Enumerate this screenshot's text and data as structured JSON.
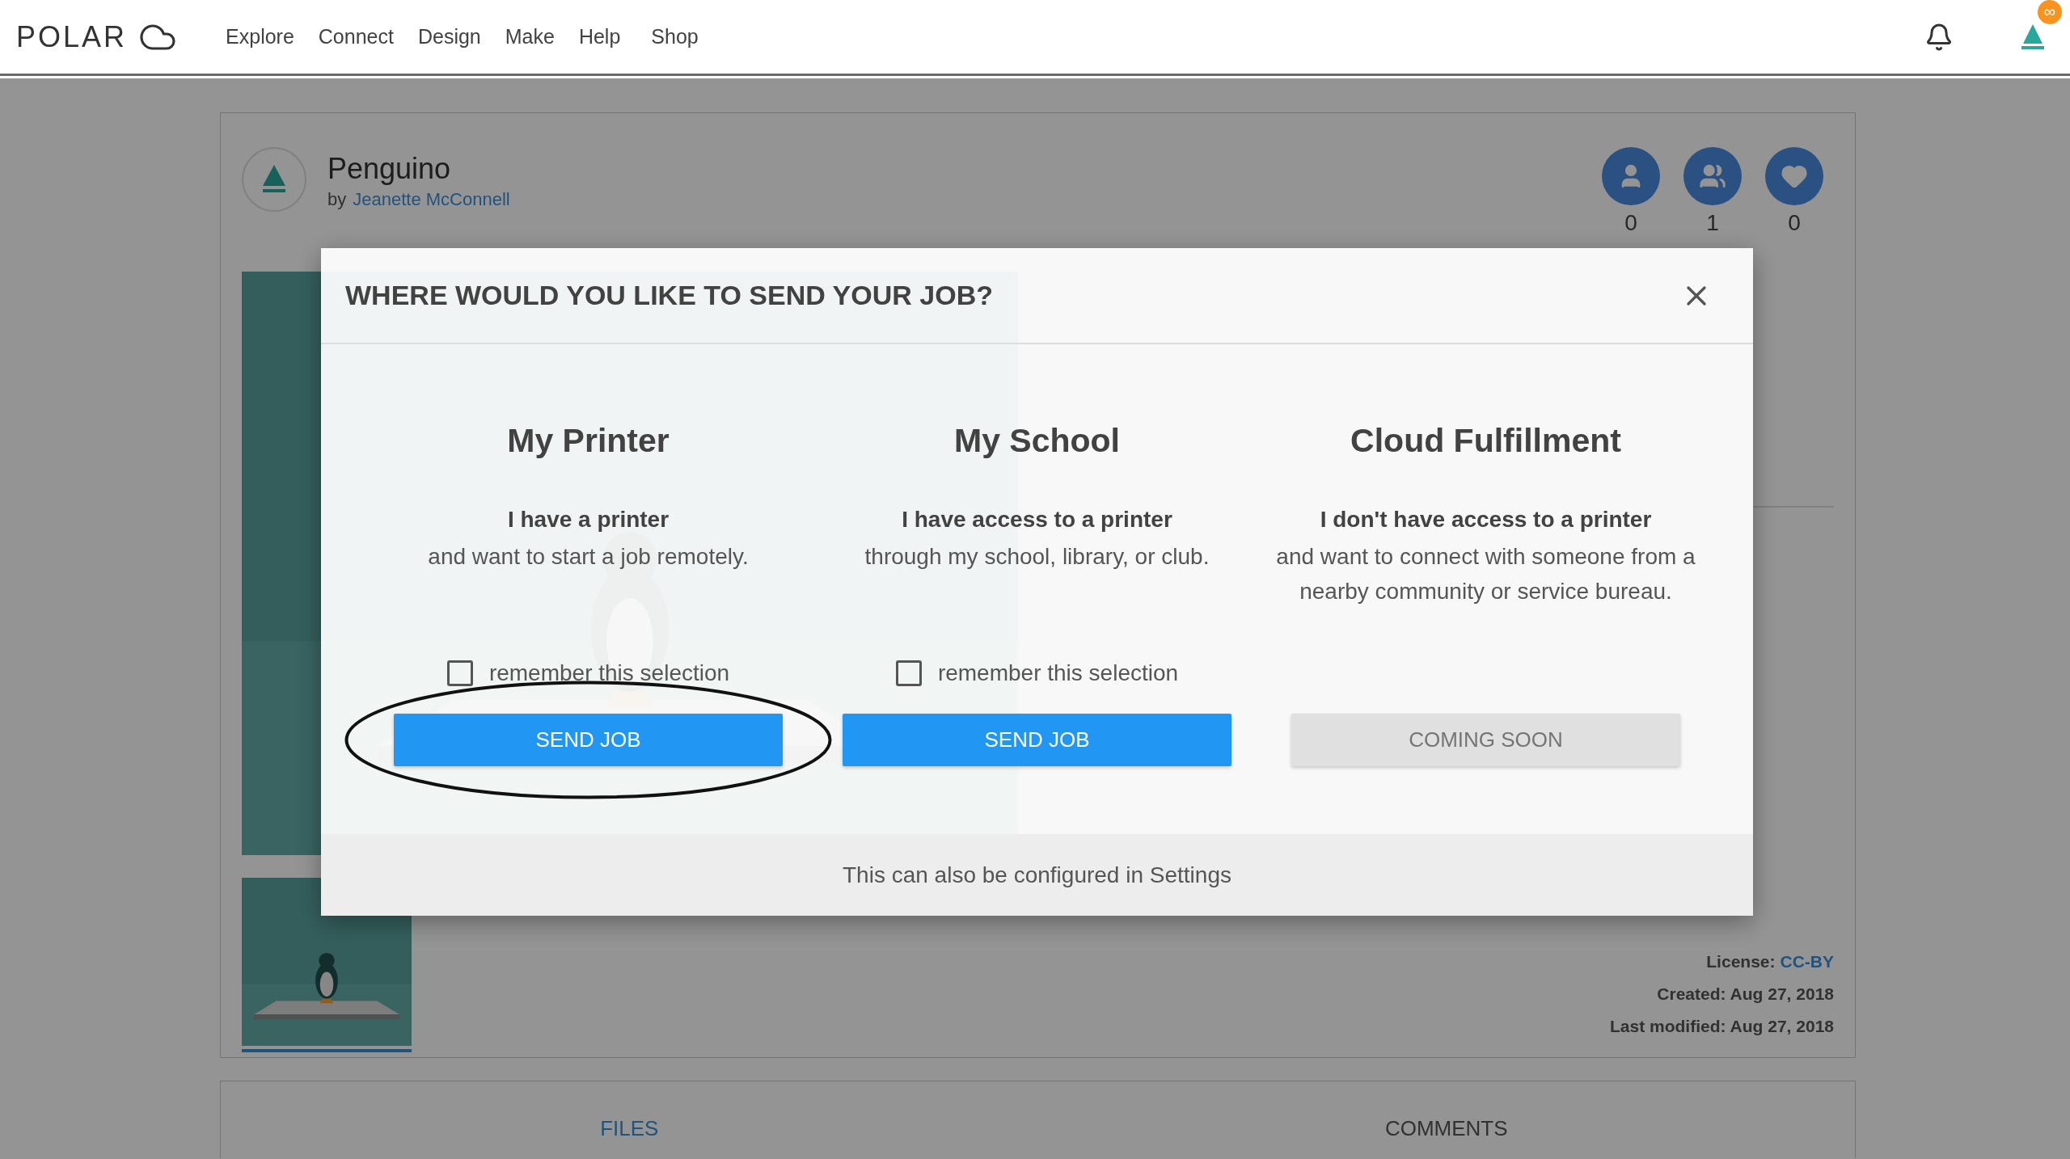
{
  "topbar": {
    "logo": "POLAR",
    "nav": [
      "Explore",
      "Connect",
      "Design",
      "Make",
      "Help",
      "Shop"
    ],
    "badge": "∞"
  },
  "project": {
    "title": "Penguino",
    "by": "by",
    "author": "Jeanette McConnell",
    "stats": [
      {
        "kind": "person",
        "count": "0"
      },
      {
        "kind": "group",
        "count": "1"
      },
      {
        "kind": "heart",
        "count": "0"
      }
    ],
    "meta": [
      {
        "label": "License:",
        "value": "CC-BY",
        "link": true
      },
      {
        "label": "Created:",
        "value": "Aug 27, 2018",
        "link": false
      },
      {
        "label": "Last modified:",
        "value": "Aug 27, 2018",
        "link": false
      }
    ]
  },
  "bottom_tabs": [
    {
      "label": "FILES",
      "selected": true
    },
    {
      "label": "COMMENTS",
      "selected": false
    }
  ],
  "dialog": {
    "title": "WHERE WOULD YOU LIKE TO SEND YOUR JOB?",
    "options": [
      {
        "heading": "My Printer",
        "lead": "I have a printer",
        "text": "and want to start a job remotely.",
        "remember": {
          "label": "remember this selection",
          "checked": false
        },
        "button": {
          "label": "SEND JOB",
          "disabled": false
        },
        "circled": true
      },
      {
        "heading": "My School",
        "lead": "I have access to a printer",
        "text": "through my school, library, or club.",
        "remember": {
          "label": "remember this selection",
          "checked": false
        },
        "button": {
          "label": "SEND JOB",
          "disabled": false
        },
        "circled": false
      },
      {
        "heading": "Cloud Fulfillment",
        "lead": "I don't have access to a printer",
        "text": "and want to connect with someone from a nearby community or service bureau.",
        "button": {
          "label": "COMING SOON",
          "disabled": true
        },
        "circled": false
      }
    ],
    "footer": "This can also be configured in Settings"
  }
}
